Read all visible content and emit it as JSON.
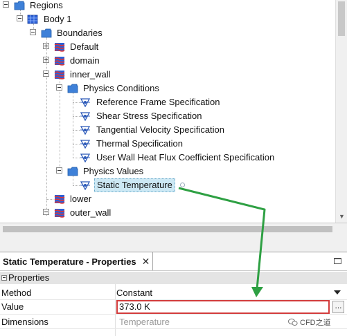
{
  "tree": {
    "regions": "Regions",
    "body1": "Body 1",
    "boundaries": "Boundaries",
    "default": "Default",
    "domain": "domain",
    "inner_wall": "inner_wall",
    "physics_conditions": "Physics Conditions",
    "conditions": [
      "Reference Frame Specification",
      "Shear Stress Specification",
      "Tangential Velocity Specification",
      "Thermal Specification",
      "User Wall Heat Flux Coefficient Specification"
    ],
    "physics_values": "Physics Values",
    "static_temperature": "Static Temperature",
    "lower": "lower",
    "outer_wall": "outer_wall"
  },
  "properties_panel": {
    "tab_title": "Static Temperature - Properties",
    "close_glyph": "✕",
    "group_label": "Properties",
    "rows": [
      {
        "name": "Method",
        "value": "Constant"
      },
      {
        "name": "Value",
        "value": "373.0 K"
      },
      {
        "name": "Dimensions",
        "value": "Temperature"
      }
    ],
    "ellipsis": "..."
  },
  "watermark": "CFD之道",
  "colors": {
    "highlight_box": "#d23b3b",
    "annotation_arrow": "#2ea043",
    "selection": "#cce8f4"
  }
}
